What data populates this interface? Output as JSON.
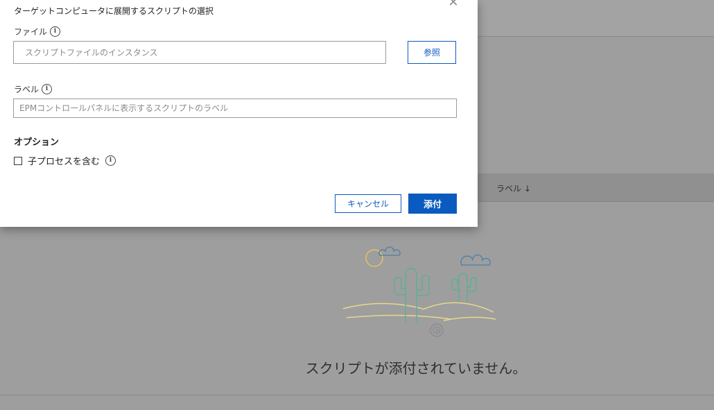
{
  "background": {
    "table_header": {
      "label_column": "ラベル ↓"
    },
    "empty_state": {
      "message": "スクリプトが添付されていません。"
    }
  },
  "dialog": {
    "subtitle": "ターゲットコンピュータに展開するスクリプトの選択",
    "close_icon": "close-icon",
    "file": {
      "label": "ファイル",
      "info_glyph": "i",
      "value": "",
      "placeholder": "スクリプトファイルのインスタンス",
      "browse_label": "参照"
    },
    "label_field": {
      "label": "ラベル",
      "info_glyph": "i",
      "value": "",
      "placeholder": "EPMコントロールパネルに表示するスクリプトのラベル"
    },
    "options": {
      "title": "オプション",
      "include_child_label": "子プロセスを含む",
      "info_glyph": "i",
      "checked": false
    },
    "buttons": {
      "cancel": "キャンセル",
      "attach": "添付"
    }
  },
  "colors": {
    "accent": "#0a5bbf",
    "overlay": "#9e9e9e",
    "illustration_stroke": "#e8d88a",
    "cactus": "#5fae97",
    "cloud": "#4a7fa8"
  }
}
